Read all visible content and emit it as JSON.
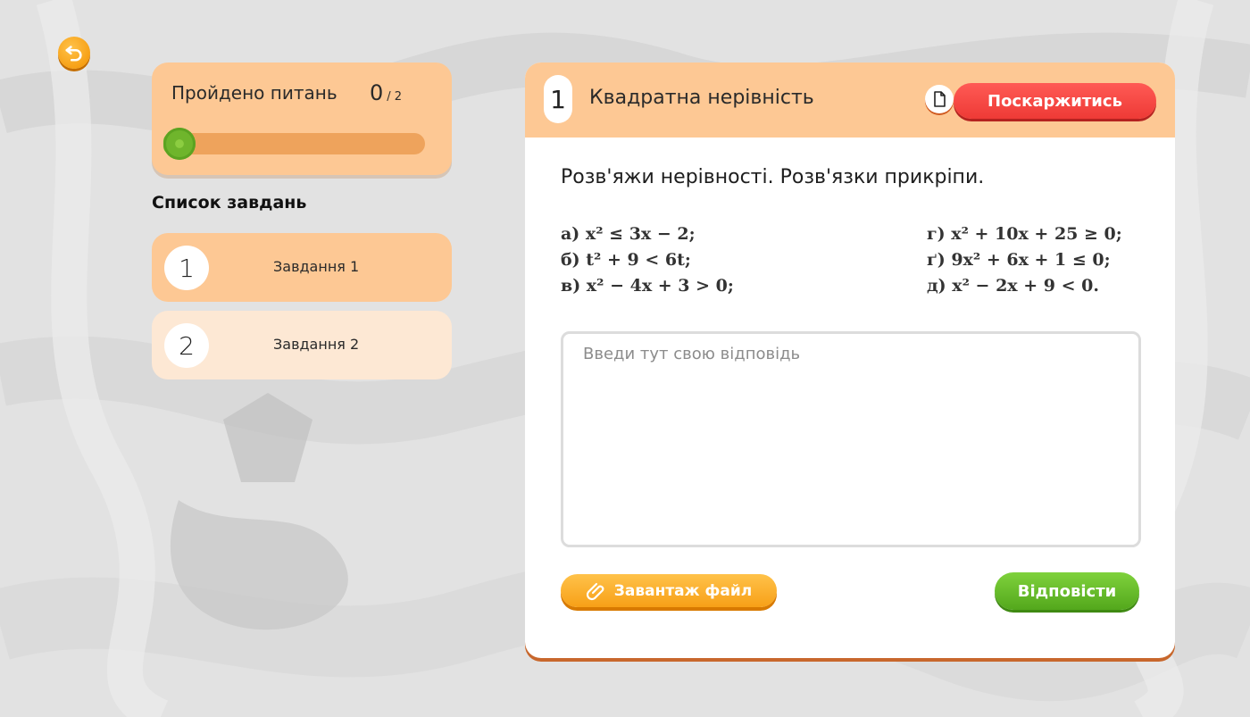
{
  "progress": {
    "title": "Пройдено питань",
    "done": "0",
    "total": "/ 2",
    "fraction": 0.0
  },
  "task_list": {
    "title": "Список завдань",
    "items": [
      {
        "number": "1",
        "label": "Завдання 1",
        "active": true
      },
      {
        "number": "2",
        "label": "Завдання 2",
        "active": false
      }
    ]
  },
  "task": {
    "number": "1",
    "title": "Квадратна нерівність",
    "complain_label": "Поскаржитись",
    "prompt": "Розв'яжи нерівності. Розв'язки прикріпи.",
    "inequalities_left": "а) x² ≤ 3x − 2;\nб) t² + 9 < 6t;\nв) x² − 4x + 3 > 0;",
    "inequalities_right": "г) x² + 10x + 25 ≥ 0;\nґ) 9x² + 6x + 1 ≤ 0;\nд) x² − 2x + 9 < 0.",
    "answer_placeholder": "Введи тут свою відповідь",
    "upload_label": "Завантаж файл",
    "submit_label": "Відповісти"
  },
  "icons": {
    "back": "undo-arrow-icon",
    "document": "document-icon",
    "attach": "paperclip-icon"
  },
  "colors": {
    "accent_orange": "#fdc894",
    "complain_red": "#ee3a36",
    "submit_green": "#53a81c",
    "upload_orange": "#f7a017"
  }
}
